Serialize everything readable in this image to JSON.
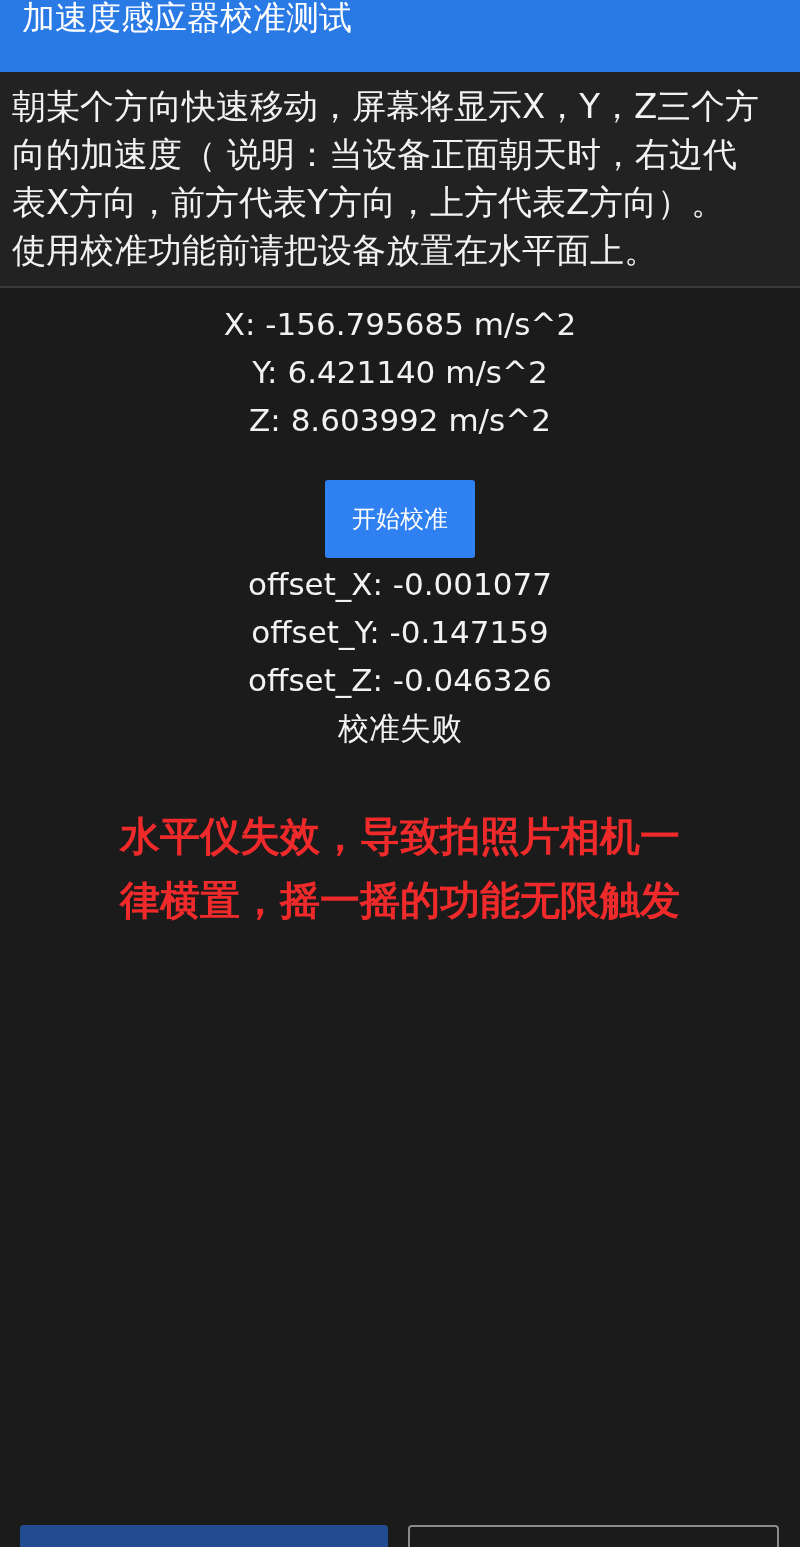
{
  "app_bar": {
    "title": "加速度感应器校准测试"
  },
  "description": {
    "lines": [
      "朝某个方向快速移动，屏幕将显示X，Y，Z三个方",
      "向的加速度（ 说明：当设备正面朝天时，右边代",
      "表X方向，前方代表Y方向，上方代表Z方向）。",
      "使用校准功能前请把设备放置在水平面上。"
    ]
  },
  "readings": [
    "X: -156.795685 m/s^2",
    "Y: 6.421140 m/s^2",
    "Z: 8.603992 m/s^2"
  ],
  "calibrate_button": {
    "label": "开始校准"
  },
  "offsets": [
    "offset_X: -0.001077",
    "offset_Y: -0.147159",
    "offset_Z: -0.046326"
  ],
  "calibration_status": "校准失败",
  "annotation": {
    "lines": [
      "水平仪失效，导致拍照片相机一",
      "律横置，摇一摇的功能无限触发"
    ]
  },
  "bottom_buttons": [
    {
      "kind": "filled"
    },
    {
      "kind": "outlined"
    }
  ]
}
